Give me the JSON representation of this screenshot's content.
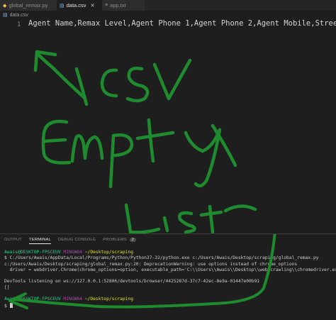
{
  "tabs": [
    {
      "label": "global_remax.py",
      "icon": "python-file-icon",
      "active": false
    },
    {
      "label": "data.csv",
      "icon": "csv-file-icon",
      "active": true
    },
    {
      "label": "app.txt",
      "icon": "text-file-icon",
      "active": false
    }
  ],
  "breadcrumb": {
    "file": "data.csv"
  },
  "editor": {
    "line_number": "1",
    "line_text": "Agent Name,Remax Level,Agent Phone 1,Agent Phone 2,Agent Mobile,Street Addres"
  },
  "annotations": {
    "csv": "\\csv",
    "empty": "Empty",
    "list": "List",
    "color": "#1e8c2e"
  },
  "panel": {
    "tabs": [
      "OUTPUT",
      "TERMINAL",
      "DEBUG CONSOLE",
      "PROBLEMS"
    ],
    "active_tab": "TERMINAL",
    "problems_count": "2"
  },
  "terminal": {
    "prompt1": {
      "user": "Awais@DESKTOP-FPSCEUV",
      "shell": "MINGW64",
      "path": "~/Desktop/scraping"
    },
    "cmd": "$ C:/Users/Awais/AppData/Local/Programs/Python/Python37-32/python.exe c:/Users/Awais/Desktop/scraping/global_remax.py",
    "warn1": "c:/Users/Awais/Desktop/scraping/global_remax.py:20: DeprecationWarning: use options instead of chrome_options",
    "warn2": "  driver = webdriver.Chrome(chrome_options=option, executable_path='C:\\\\Users\\\\Awais\\\\Desktop\\\\web crawling\\\\chromedriver.exe')",
    "devtools": "DevTools listening on ws://127.0.0.1:52806/devtools/browser/4425287d-37c7-42ec-8e9a-01447e00b91",
    "result": "[]",
    "prompt2": {
      "user": "Awais@DESKTOP-FPSCEUV",
      "shell": "MINGW64",
      "path": "~/Desktop/scraping"
    },
    "dollar": "$"
  }
}
